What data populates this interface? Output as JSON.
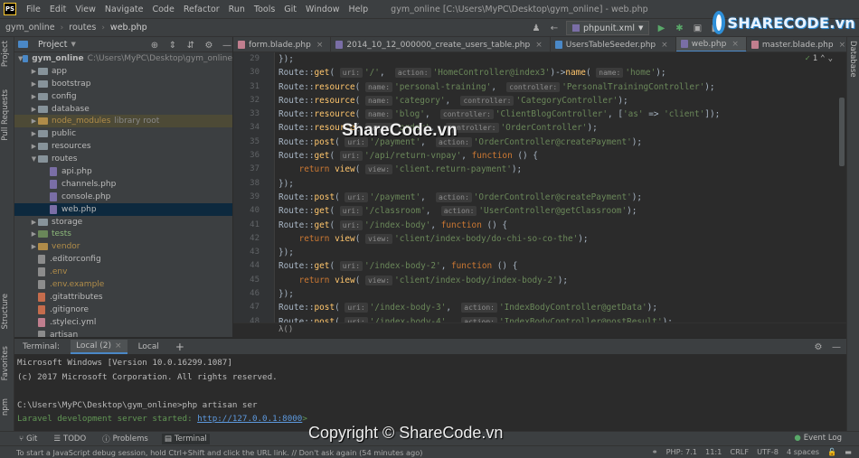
{
  "app": {
    "window_title": "gym_online [C:\\Users\\MyPC\\Desktop\\gym_online] - web.php",
    "menu": [
      "File",
      "Edit",
      "View",
      "Navigate",
      "Code",
      "Refactor",
      "Run",
      "Tools",
      "Git",
      "Window",
      "Help"
    ]
  },
  "breadcrumb": [
    "gym_online",
    "routes",
    "web.php"
  ],
  "toolbar": {
    "run_config": "phpunit.xml"
  },
  "left_stripe": [
    "Project",
    "Pull Requests",
    "Structure",
    "Favorites",
    "npm"
  ],
  "right_stripe": [
    "Database"
  ],
  "project": {
    "title": "Project",
    "tree": [
      {
        "label": "gym_online",
        "hint": "C:\\Users\\MyPC\\Desktop\\gym_online",
        "kind": "folder",
        "depth": 0,
        "expanded": true
      },
      {
        "label": "app",
        "kind": "folder",
        "depth": 1
      },
      {
        "label": "bootstrap",
        "kind": "folder",
        "depth": 1
      },
      {
        "label": "config",
        "kind": "folder",
        "depth": 1
      },
      {
        "label": "database",
        "kind": "folder",
        "depth": 1
      },
      {
        "label": "node_modules",
        "hint": "library root",
        "kind": "folder-orange",
        "depth": 1
      },
      {
        "label": "public",
        "kind": "folder",
        "depth": 1
      },
      {
        "label": "resources",
        "kind": "folder",
        "depth": 1
      },
      {
        "label": "routes",
        "kind": "folder",
        "depth": 1,
        "expanded": true
      },
      {
        "label": "api.php",
        "kind": "php",
        "depth": 2
      },
      {
        "label": "channels.php",
        "kind": "php",
        "depth": 2
      },
      {
        "label": "console.php",
        "kind": "php",
        "depth": 2
      },
      {
        "label": "web.php",
        "kind": "php",
        "depth": 2,
        "selected": true
      },
      {
        "label": "storage",
        "kind": "folder",
        "depth": 1
      },
      {
        "label": "tests",
        "kind": "folder-green",
        "depth": 1
      },
      {
        "label": "vendor",
        "kind": "folder-orange",
        "depth": 1
      },
      {
        "label": ".editorconfig",
        "kind": "cfg",
        "depth": 1
      },
      {
        "label": ".env",
        "kind": "cfg",
        "depth": 1
      },
      {
        "label": ".env.example",
        "kind": "cfg",
        "depth": 1
      },
      {
        "label": ".gitattributes",
        "kind": "git",
        "depth": 1
      },
      {
        "label": ".gitignore",
        "kind": "git",
        "depth": 1
      },
      {
        "label": ".styleci.yml",
        "kind": "yml",
        "depth": 1
      },
      {
        "label": "artisan",
        "kind": "cfg",
        "depth": 1
      }
    ]
  },
  "editor": {
    "tabs": [
      {
        "label": "form.blade.php",
        "color": "#c07e8e"
      },
      {
        "label": "2014_10_12_000000_create_users_table.php",
        "color": "#7a6ea6"
      },
      {
        "label": "UsersTableSeeder.php",
        "color": "#4a88c7"
      },
      {
        "label": "web.php",
        "color": "#7a6ea6",
        "active": true
      },
      {
        "label": "master.blade.php",
        "color": "#c07e8e"
      }
    ],
    "inspection_count": "1",
    "line_numbers": [
      "29",
      "30",
      "31",
      "32",
      "33",
      "34",
      "35",
      "36",
      "37",
      "38",
      "39",
      "40",
      "41",
      "42",
      "43",
      "44",
      "45",
      "46",
      "47",
      "48"
    ],
    "lambda": "λ()"
  },
  "terminal": {
    "label": "Terminal:",
    "tabs": [
      "Local (2)",
      "Local"
    ],
    "lines": [
      "Microsoft Windows [Version 10.0.16299.1087]",
      "(c) 2017 Microsoft Corporation. All rights reserved.",
      "",
      "C:\\Users\\MyPC\\Desktop\\gym_online>php artisan ser",
      "Laravel development server started: "
    ],
    "url": "http://127.0.0.1:8000",
    "url_suffix": ">"
  },
  "tool_windows": [
    "Git",
    "TODO",
    "Problems",
    "Terminal"
  ],
  "event_log": "Event Log",
  "status": {
    "message": "To start a JavaScript debug session, hold Ctrl+Shift and click the URL link. // Don't ask again (54 minutes ago)",
    "php": "PHP: 7.1",
    "position": "11:1",
    "line_sep": "CRLF",
    "encoding": "UTF-8",
    "indent": "4 spaces"
  },
  "watermarks": {
    "logo": "SHARECODE.vn",
    "center": "ShareCode.vn",
    "copyright": "Copyright © ShareCode.vn"
  }
}
